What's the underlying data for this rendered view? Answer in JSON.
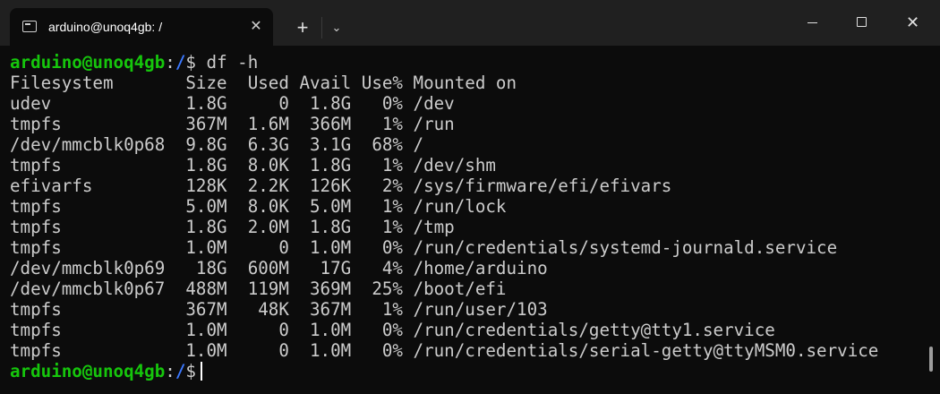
{
  "window": {
    "tab_title": "arduino@unoq4gb: /",
    "tab_close": "✕",
    "new_tab": "+",
    "dropdown": "⌄",
    "close": "✕"
  },
  "prompt": {
    "user_host": "arduino@unoq4gb",
    "colon": ":",
    "path": "/",
    "symbol": "$",
    "command": "df -h"
  },
  "df_output": {
    "header": "Filesystem       Size  Used Avail Use% Mounted on",
    "rows": [
      "udev             1.8G     0  1.8G   0% /dev",
      "tmpfs            367M  1.6M  366M   1% /run",
      "/dev/mmcblk0p68  9.8G  6.3G  3.1G  68% /",
      "tmpfs            1.8G  8.0K  1.8G   1% /dev/shm",
      "efivarfs         128K  2.2K  126K   2% /sys/firmware/efi/efivars",
      "tmpfs            5.0M  8.0K  5.0M   1% /run/lock",
      "tmpfs            1.8G  2.0M  1.8G   1% /tmp",
      "tmpfs            1.0M     0  1.0M   0% /run/credentials/systemd-journald.service",
      "/dev/mmcblk0p69   18G  600M   17G   4% /home/arduino",
      "/dev/mmcblk0p67  488M  119M  369M  25% /boot/efi",
      "tmpfs            367M   48K  367M   1% /run/user/103",
      "tmpfs            1.0M     0  1.0M   0% /run/credentials/getty@tty1.service",
      "tmpfs            1.0M     0  1.0M   0% /run/credentials/serial-getty@ttyMSM0.service"
    ]
  },
  "colors": {
    "prompt_user": "#16c60c",
    "prompt_path": "#3b78ff",
    "text": "#cccccc",
    "background": "#0c0c0c",
    "titlebar": "#202020"
  }
}
